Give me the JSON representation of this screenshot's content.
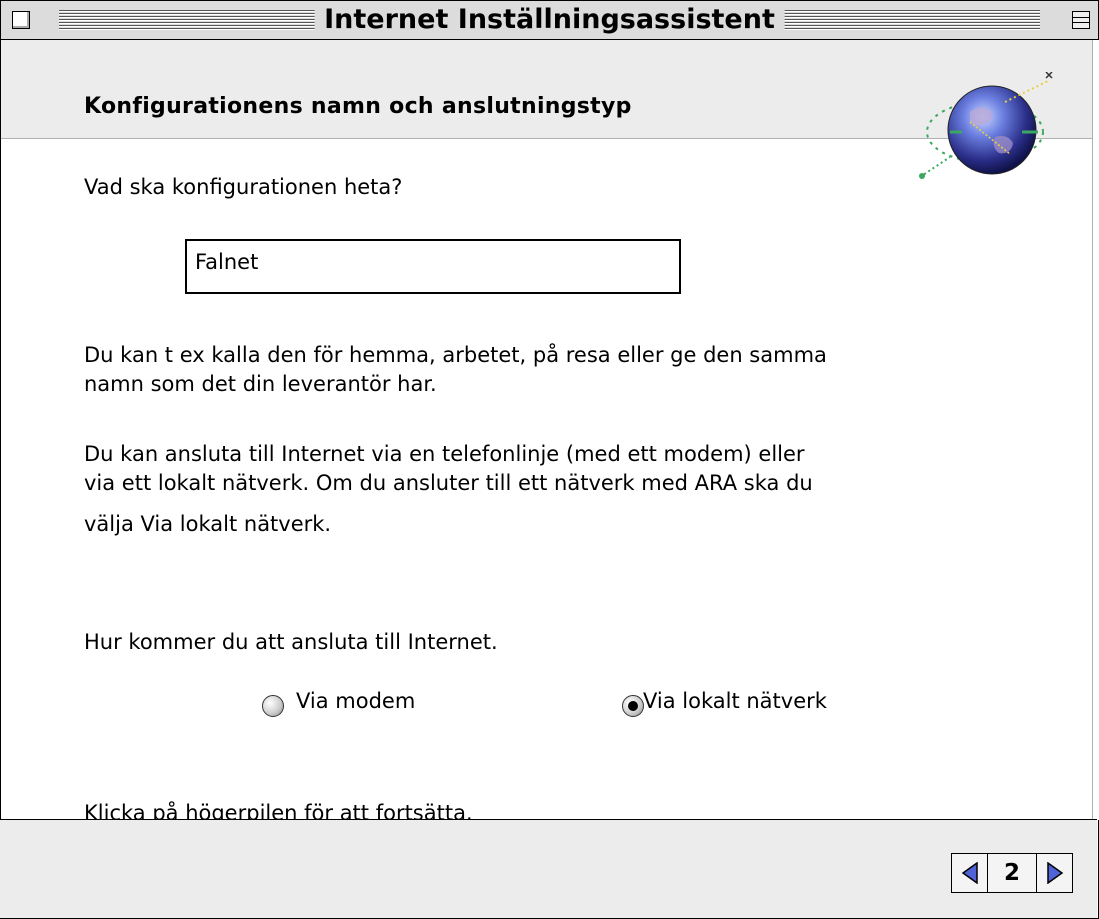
{
  "window": {
    "title": "Internet Inställningsassistent"
  },
  "header": {
    "title": "Konfigurationens namn och anslutningstyp",
    "icon": "globe-icon"
  },
  "content": {
    "name_question": "Vad ska konfigurationen heta?",
    "name_value": "Falnet",
    "name_help_line1": "Du kan t ex kalla den för hemma, arbetet, på resa eller ge den samma",
    "name_help_line2": "namn som det din leverantör har.",
    "connect_info_line1": "Du kan ansluta till Internet via en telefonlinje (med ett modem) eller",
    "connect_info_line2": "via ett lokalt nätverk. Om du ansluter till ett nätverk med ARA ska du",
    "connect_info_line3": "välja Via lokalt nätverk.",
    "connect_question": "Hur kommer du att ansluta till Internet.",
    "option_modem": "Via modem",
    "option_lan": "Via lokalt nätverk",
    "selected_option": "Via lokalt nätverk",
    "continue_hint": "Klicka på högerpilen för att fortsätta."
  },
  "footer": {
    "page_number": "2"
  },
  "colors": {
    "titlebar": "#dcdcdc",
    "panel": "#ececec",
    "arrow": "#4f63d6"
  }
}
